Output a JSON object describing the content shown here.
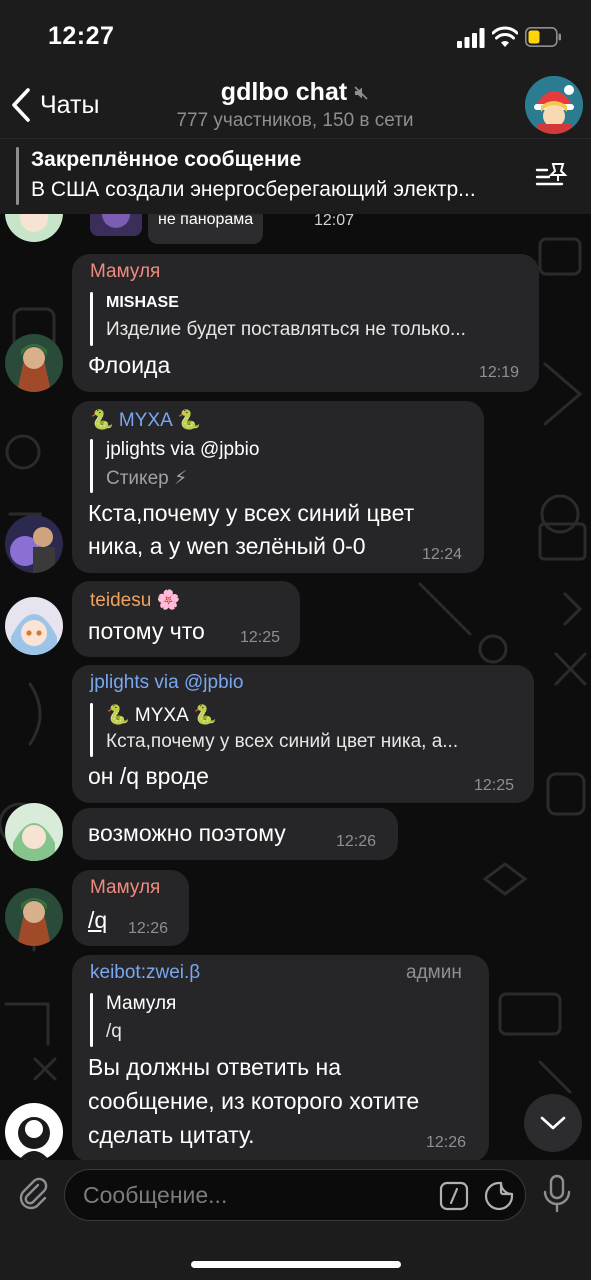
{
  "status_bar": {
    "time": "12:27"
  },
  "header": {
    "back_label": "Чаты",
    "title": "gdlbo chat",
    "subtitle": "777 участников, 150 в сети"
  },
  "pinned": {
    "title": "Закреплённое сообщение",
    "text": "В США создали энергосберегающий электр..."
  },
  "messages": [
    {
      "text": "не панорама",
      "time": "12:07"
    },
    {
      "sender": "Мамуля",
      "sender_color": "#f08a7e",
      "reply_name": "MISHASE",
      "reply_text": "Изделие будет поставляться не только...",
      "text": "Флоида",
      "time": "12:19"
    },
    {
      "sender": "🐍 MYXA 🐍",
      "sender_color": "#7aa7f0",
      "reply_name": "jplights via @jpbio",
      "reply_text": "Стикер ⚡",
      "text_lines": [
        "Кста,почему у всех синий цвет",
        "ника, а у wen зелёный 0-0"
      ],
      "time": "12:24"
    },
    {
      "sender": "teidesu 🌸",
      "sender_color": "#f0a35e",
      "text": "потому что",
      "time": "12:25"
    },
    {
      "sender": "jplights via @jpbio",
      "sender_color": "#7aa7f0",
      "reply_name": "🐍 MYXA 🐍",
      "reply_text": "Кста,почему у всех синий цвет ника, а...",
      "text": "он /q вроде",
      "time": "12:25"
    },
    {
      "text": "возможно поэтому",
      "time": "12:26"
    },
    {
      "sender": "Мамуля",
      "sender_color": "#f08a7e",
      "text": "/q",
      "time": "12:26"
    },
    {
      "sender": "keibot:zwei.β",
      "sender_color": "#7aa7f0",
      "badge": "админ",
      "reply_name": "Мамуля",
      "reply_text": "/q",
      "text_lines": [
        "Вы должны ответить на",
        "сообщение, из которого хотите",
        "сделать цитату."
      ],
      "time": "12:26"
    }
  ],
  "input": {
    "placeholder": "Сообщение..."
  },
  "colors": {
    "bubble": "#262628",
    "bar": "#1c1c1d",
    "background": "#0d0d0d",
    "accent": "#7aa7f0"
  },
  "icons": [
    "back-icon",
    "mute-icon",
    "pin-list-icon",
    "attach-icon",
    "command-icon",
    "sticker-icon",
    "mic-icon",
    "chevron-down-icon"
  ]
}
